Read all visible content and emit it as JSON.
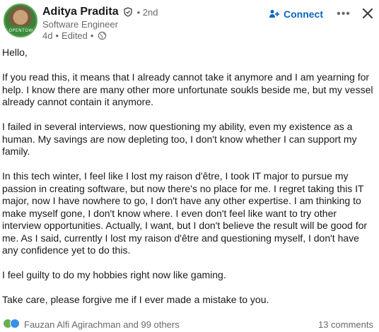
{
  "author": {
    "name": "Aditya Pradita",
    "degree": "• 2nd",
    "headline": "Software Engineer",
    "age": "4d",
    "edited": "Edited"
  },
  "actions": {
    "connect_label": "Connect",
    "more_label": "•••"
  },
  "post": {
    "paragraphs": [
      "Hello,",
      "If you read this, it means that I already cannot take it anymore and I am yearning for help. I know there are many other more unfortunate soukls beside me, but my vessel already cannot contain it anymore.",
      "I failed in several interviews, now questioning my ability, even my existence as a human. My savings are now depleting too, I don't know whether I can support my family.",
      "In this tech winter, I feel like I lost my raison d'être, I took IT major to pursue my passion in creating software, but now there's no place for me. I regret taking this IT major, now I have nowhere to go, I don't have any other expertise. I am thinking to make myself gone, I don't know where. I even don't feel like want to try other interview opportunities. Actually, I want, but I don't believe the result will be good for me. As I said, currently I lost my raison d'être and questioning myself, I don't have any confidence yet to do this.",
      "I feel guilty to do my hobbies right now like gaming.",
      "Take care, please forgive me if I ever made a mistake to you."
    ]
  },
  "footer": {
    "reactors": "Fauzan Alfi Agirachman and 99 others",
    "comments": "13 comments"
  },
  "colors": {
    "accent": "#0a66c2",
    "text": "#000000e6",
    "muted": "#00000099"
  }
}
